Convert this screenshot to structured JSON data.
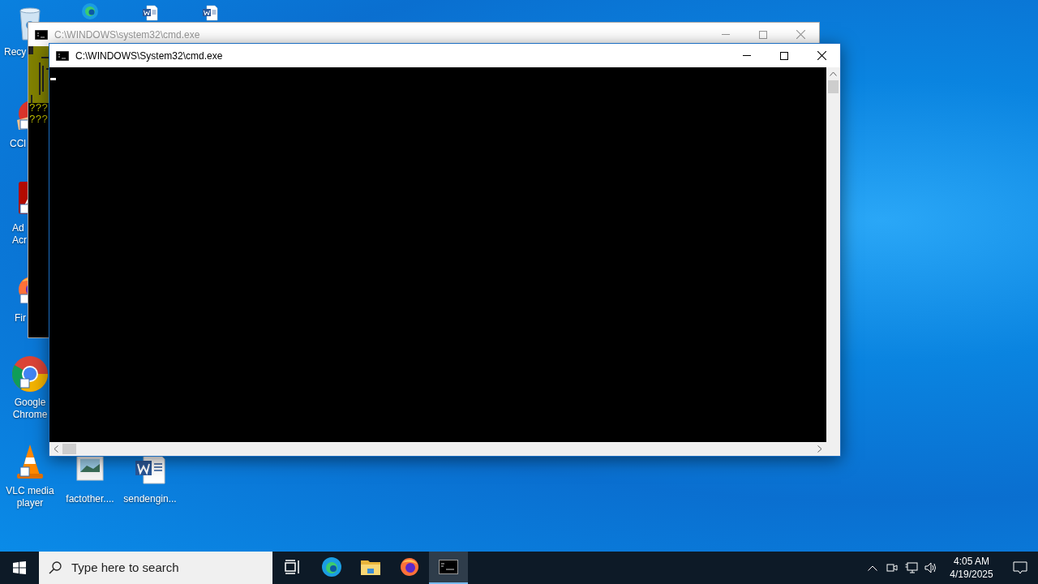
{
  "desktop": {
    "icons": [
      {
        "kind": "recycle-bin",
        "label": "Recy"
      },
      {
        "kind": "ccleaner",
        "label": "CCl"
      },
      {
        "kind": "acrobat",
        "label": "Ad\nAcr"
      },
      {
        "kind": "firefox",
        "label": "Fir"
      },
      {
        "kind": "chrome",
        "label": "Google\nChrome"
      },
      {
        "kind": "vlc",
        "label": "VLC media\nplayer"
      },
      {
        "kind": "edge"
      },
      {
        "kind": "image-file",
        "label": "factother...."
      },
      {
        "kind": "word-file"
      },
      {
        "kind": "word-file",
        "label": "sendengin..."
      },
      {
        "kind": "word-file"
      }
    ]
  },
  "windows": [
    {
      "title": "C:\\WINDOWS\\system32\\cmd.exe",
      "active": false,
      "lines": [
        "???",
        "???"
      ]
    },
    {
      "title": "C:\\WINDOWS\\System32\\cmd.exe",
      "active": true
    }
  ],
  "taskbar": {
    "search": {
      "placeholder": "Type here to search"
    },
    "apps": [
      {
        "kind": "task-view",
        "selected": false
      },
      {
        "kind": "edge",
        "selected": false
      },
      {
        "kind": "explorer",
        "selected": false
      },
      {
        "kind": "firefox",
        "selected": false
      },
      {
        "kind": "console",
        "selected": true
      }
    ],
    "clock": {
      "time": "4:05 AM",
      "date": "4/19/2025"
    }
  }
}
